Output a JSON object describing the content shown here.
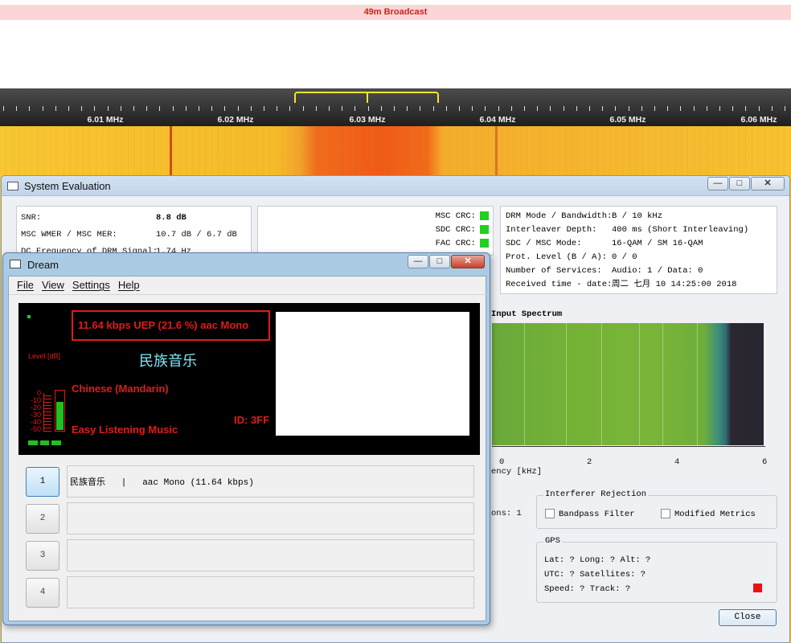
{
  "sdr": {
    "band_label": "49m Broadcast",
    "freq_labels": [
      "6.01 MHz",
      "6.02 MHz",
      "6.03 MHz",
      "6.04 MHz",
      "6.05 MHz",
      "6.06 MHz"
    ]
  },
  "syseval": {
    "title": "System Evaluation",
    "snr_label": "SNR:",
    "snr_value": "8.8 dB",
    "mer_label": "MSC WMER / MSC MER:",
    "mer_value": "10.7 dB / 6.7 dB",
    "dc_label": "DC Frequency of DRM Signal:",
    "dc_value": "1.74 Hz",
    "crc": [
      {
        "label": "MSC CRC:",
        "color": "#20d020"
      },
      {
        "label": "SDC CRC:",
        "color": "#20d020"
      },
      {
        "label": "FAC CRC:",
        "color": "#20d020"
      }
    ],
    "info": [
      {
        "label": "DRM Mode / Bandwidth:",
        "value": "B / 10 kHz"
      },
      {
        "label": "Interleaver Depth:",
        "value": "400 ms (Short Interleaving)"
      },
      {
        "label": "SDC / MSC Mode:",
        "value": "16-QAM / SM 16-QAM"
      },
      {
        "label": "Prot. Level (B / A):",
        "value": "0 / 0"
      },
      {
        "label": "Number of Services:",
        "value": "Audio: 1 / Data: 0"
      },
      {
        "label": "Received time - date:",
        "value": "周二 七月 10 14:25:00 2018"
      }
    ],
    "spectrum_title": "Input Spectrum",
    "spectrum_ticks": [
      "0",
      "2",
      "4",
      "6"
    ],
    "spectrum_xlabel": "ency [kHz]",
    "left_fragment": "ons: 1",
    "interferer": {
      "title": "Interferer Rejection",
      "bandpass_label": "Bandpass Filter",
      "metrics_label": "Modified Metrics"
    },
    "gps": {
      "title": "GPS",
      "line1": "Lat: ?  Long: ?  Alt: ?",
      "line2": "UTC: ?  Satellites: ?",
      "line3": "Speed: ?  Track: ?",
      "status_color": "#ee1111"
    },
    "close_label": "Close"
  },
  "dream": {
    "title": "Dream",
    "menu": [
      "File",
      "View",
      "Settings",
      "Help"
    ],
    "status_text": "11.64 kbps UEP (21.6 %)   aac   Mono",
    "level_label": "Level [dB]",
    "scale": [
      "0",
      "-10",
      "-20",
      "-30",
      "-40",
      "-50"
    ],
    "level_fraction": 0.72,
    "station_label": "民族音乐",
    "language": "Chinese (Mandarin)",
    "genre": "Easy Listening Music",
    "service_id": "ID: 3FF",
    "services": [
      {
        "num": "1",
        "text": "民族音乐   |   aac Mono (11.64 kbps)",
        "active": true
      },
      {
        "num": "2",
        "text": "",
        "active": false
      },
      {
        "num": "3",
        "text": "",
        "active": false
      },
      {
        "num": "4",
        "text": "",
        "active": false
      }
    ]
  }
}
